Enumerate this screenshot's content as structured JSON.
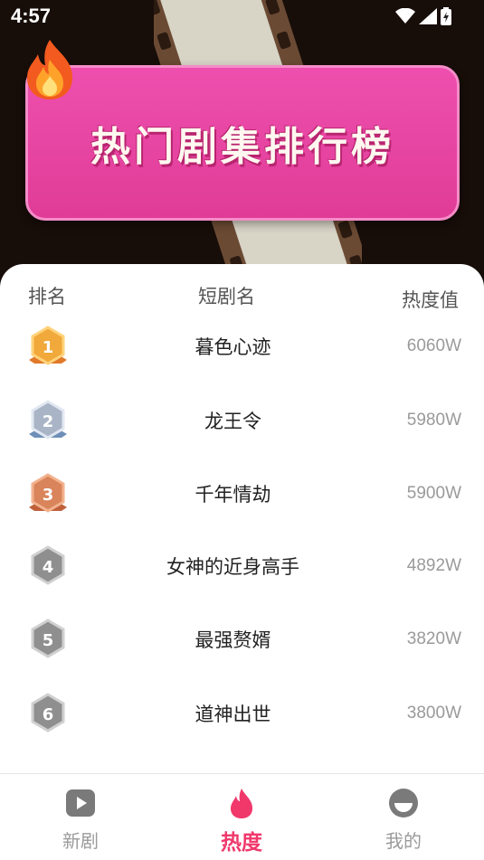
{
  "status_bar": {
    "time": "4:57"
  },
  "banner": {
    "title": "热门剧集排行榜"
  },
  "table": {
    "headers": {
      "rank": "排名",
      "name": "短剧名",
      "heat": "热度值"
    },
    "rows": [
      {
        "rank": "1",
        "title": "暮色心迹",
        "heat": "6060W"
      },
      {
        "rank": "2",
        "title": "龙王令",
        "heat": "5980W"
      },
      {
        "rank": "3",
        "title": "千年情劫",
        "heat": "5900W"
      },
      {
        "rank": "4",
        "title": "女神的近身高手",
        "heat": "4892W"
      },
      {
        "rank": "5",
        "title": "最强赘婿",
        "heat": "3820W"
      },
      {
        "rank": "6",
        "title": "道神出世",
        "heat": "3800W"
      }
    ]
  },
  "tabbar": {
    "items": [
      {
        "label": "新剧",
        "icon": "play-icon",
        "active": false
      },
      {
        "label": "热度",
        "icon": "flame-icon",
        "active": true
      },
      {
        "label": "我的",
        "icon": "profile-icon",
        "active": false
      }
    ]
  },
  "colors": {
    "accent": "#f0386b",
    "banner": "#e8459f",
    "gold": "#f0a93a",
    "silver": "#a9b4c6",
    "bronze": "#d9845a",
    "grey_badge": "#8f8f8f"
  }
}
